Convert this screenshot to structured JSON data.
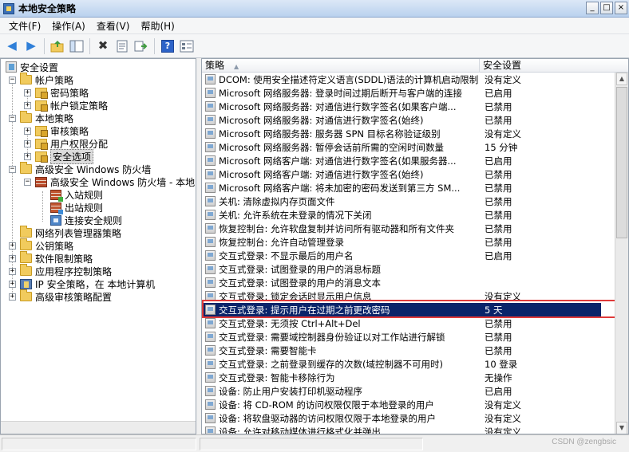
{
  "window": {
    "title": "本地安全策略",
    "controls": {
      "minimize": "_",
      "maximize": "□",
      "close": "×"
    }
  },
  "menu": [
    "文件(F)",
    "操作(A)",
    "查看(V)",
    "帮助(H)"
  ],
  "toolbar": {
    "icons": [
      "back-icon",
      "forward-icon",
      "up-folder-icon",
      "show-tree-icon",
      "delete-icon",
      "properties-icon",
      "export-icon",
      "help-icon",
      "details-view-icon"
    ],
    "help_label": "?"
  },
  "tree": {
    "items": [
      {
        "label": "安全设置",
        "icon": "shield-icon",
        "expander": "",
        "level": 0
      },
      {
        "label": "帐户策略",
        "icon": "folder-icon",
        "expander": "−",
        "level": 1
      },
      {
        "label": "密码策略",
        "icon": "lock-folder-icon",
        "expander": "+",
        "level": 2
      },
      {
        "label": "帐户锁定策略",
        "icon": "lock-folder-icon",
        "expander": "+",
        "level": 2
      },
      {
        "label": "本地策略",
        "icon": "folder-icon",
        "expander": "−",
        "level": 1
      },
      {
        "label": "审核策略",
        "icon": "lock-folder-icon",
        "expander": "+",
        "level": 2
      },
      {
        "label": "用户权限分配",
        "icon": "lock-folder-icon",
        "expander": "+",
        "level": 2
      },
      {
        "label": "安全选项",
        "icon": "lock-folder-icon",
        "expander": "+",
        "level": 2,
        "selected": true
      },
      {
        "label": "高级安全 Windows 防火墙",
        "icon": "folder-icon",
        "expander": "−",
        "level": 1
      },
      {
        "label": "高级安全 Windows 防火墙 - 本地",
        "icon": "firewall-icon",
        "expander": "−",
        "level": 2
      },
      {
        "label": "入站规则",
        "icon": "inbound-rule-icon",
        "expander": "",
        "level": 3
      },
      {
        "label": "出站规则",
        "icon": "outbound-rule-icon",
        "expander": "",
        "level": 3
      },
      {
        "label": "连接安全规则",
        "icon": "connection-rule-icon",
        "expander": "",
        "level": 3
      },
      {
        "label": "网络列表管理器策略",
        "icon": "folder-icon",
        "expander": "",
        "level": 1
      },
      {
        "label": "公钥策略",
        "icon": "folder-icon",
        "expander": "+",
        "level": 1
      },
      {
        "label": "软件限制策略",
        "icon": "folder-icon",
        "expander": "+",
        "level": 1
      },
      {
        "label": "应用程序控制策略",
        "icon": "folder-icon",
        "expander": "+",
        "level": 1
      },
      {
        "label": "IP 安全策略，在 本地计算机",
        "icon": "ip-security-icon",
        "expander": "+",
        "level": 1
      },
      {
        "label": "高级审核策略配置",
        "icon": "folder-icon",
        "expander": "+",
        "level": 1
      }
    ]
  },
  "list": {
    "columns": {
      "policy": "策略",
      "setting": "安全设置"
    },
    "rows": [
      {
        "policy": "DCOM: 使用安全描述符定义语言(SDDL)语法的计算机启动限制",
        "setting": "没有定义"
      },
      {
        "policy": "Microsoft 网络服务器: 登录时间过期后断开与客户端的连接",
        "setting": "已启用"
      },
      {
        "policy": "Microsoft 网络服务器: 对通信进行数字签名(如果客户端...",
        "setting": "已禁用"
      },
      {
        "policy": "Microsoft 网络服务器: 对通信进行数字签名(始终)",
        "setting": "已禁用"
      },
      {
        "policy": "Microsoft 网络服务器: 服务器 SPN 目标名称验证级别",
        "setting": "没有定义"
      },
      {
        "policy": "Microsoft 网络服务器: 暂停会话前所需的空闲时间数量",
        "setting": "15 分钟"
      },
      {
        "policy": "Microsoft 网络客户端: 对通信进行数字签名(如果服务器...",
        "setting": "已启用"
      },
      {
        "policy": "Microsoft 网络客户端: 对通信进行数字签名(始终)",
        "setting": "已禁用"
      },
      {
        "policy": "Microsoft 网络客户端: 将未加密的密码发送到第三方 SM...",
        "setting": "已禁用"
      },
      {
        "policy": "关机: 清除虚拟内存页面文件",
        "setting": "已禁用"
      },
      {
        "policy": "关机: 允许系统在未登录的情况下关闭",
        "setting": "已禁用"
      },
      {
        "policy": "恢复控制台: 允许软盘复制并访问所有驱动器和所有文件夹",
        "setting": "已禁用"
      },
      {
        "policy": "恢复控制台: 允许自动管理登录",
        "setting": "已禁用"
      },
      {
        "policy": "交互式登录: 不显示最后的用户名",
        "setting": "已启用"
      },
      {
        "policy": "交互式登录: 试图登录的用户的消息标题",
        "setting": ""
      },
      {
        "policy": "交互式登录: 试图登录的用户的消息文本",
        "setting": ""
      },
      {
        "policy": "交互式登录: 锁定会话时显示用户信息",
        "setting": "没有定义"
      },
      {
        "policy": "交互式登录: 提示用户在过期之前更改密码",
        "setting": "5 天",
        "selected": true
      },
      {
        "policy": "交互式登录: 无须按 Ctrl+Alt+Del",
        "setting": "已禁用"
      },
      {
        "policy": "交互式登录: 需要域控制器身份验证以对工作站进行解锁",
        "setting": "已禁用"
      },
      {
        "policy": "交互式登录: 需要智能卡",
        "setting": "已禁用"
      },
      {
        "policy": "交互式登录: 之前登录到缓存的次数(域控制器不可用时)",
        "setting": "10 登录"
      },
      {
        "policy": "交互式登录: 智能卡移除行为",
        "setting": "无操作"
      },
      {
        "policy": "设备: 防止用户安装打印机驱动程序",
        "setting": "已启用"
      },
      {
        "policy": "设备: 将 CD-ROM 的访问权限仅限于本地登录的用户",
        "setting": "没有定义"
      },
      {
        "policy": "设备: 将软盘驱动器的访问权限仅限于本地登录的用户",
        "setting": "没有定义"
      },
      {
        "policy": "设备: 允许对移动媒体进行格式化并弹出",
        "setting": "没有定义"
      }
    ]
  },
  "watermark": "CSDN @zengbsic"
}
